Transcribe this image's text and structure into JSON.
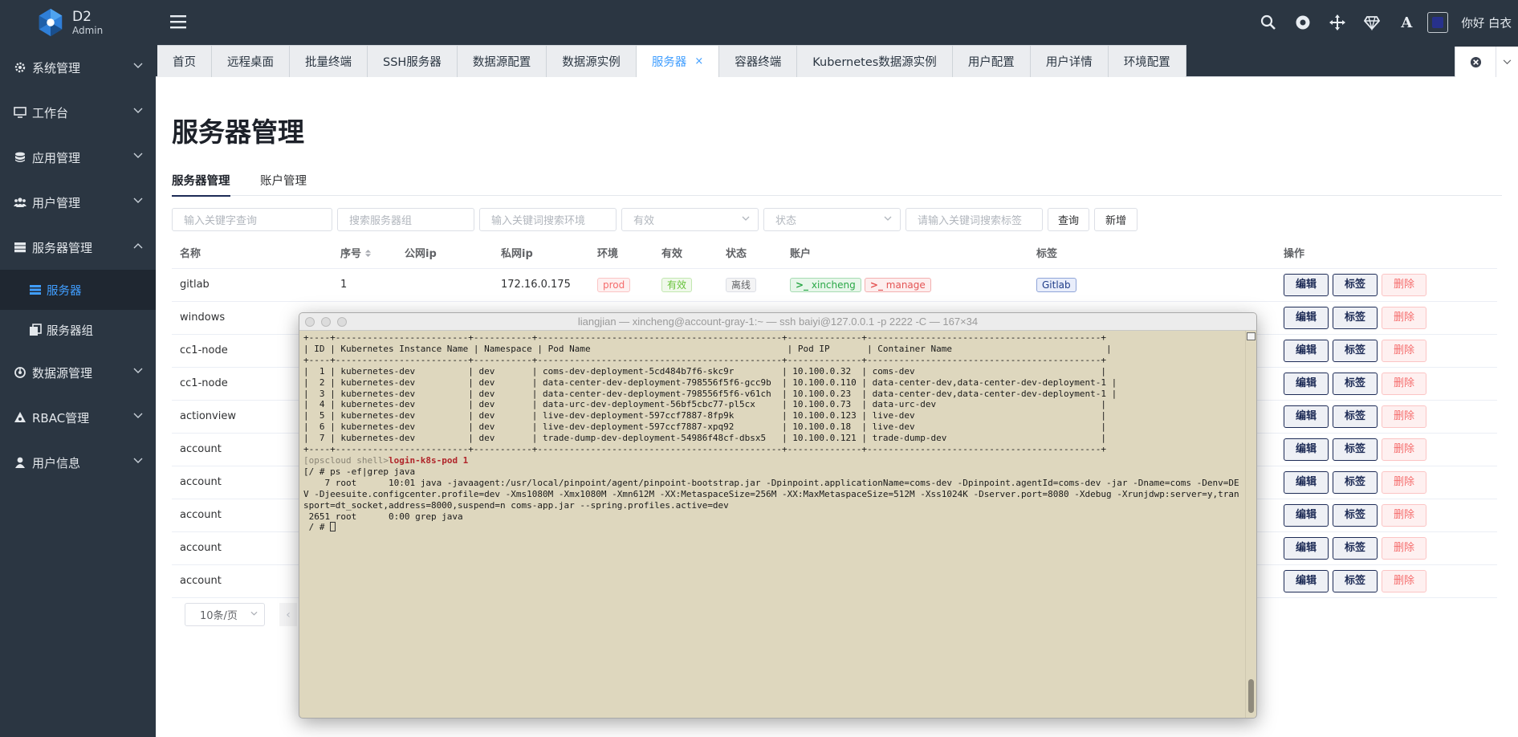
{
  "app": {
    "logo_title": "D2",
    "logo_subtitle": "Admin",
    "greeting": "你好 白衣"
  },
  "sidebar": {
    "items": [
      {
        "label": "系统管理",
        "icon": "gear-icon"
      },
      {
        "label": "工作台",
        "icon": "monitor-icon"
      },
      {
        "label": "应用管理",
        "icon": "database-icon"
      },
      {
        "label": "用户管理",
        "icon": "users-icon"
      },
      {
        "label": "服务器管理",
        "icon": "server-icon",
        "expanded": true
      },
      {
        "label": "数据源管理",
        "icon": "datasource-icon"
      },
      {
        "label": "RBAC管理",
        "icon": "rbac-icon"
      },
      {
        "label": "用户信息",
        "icon": "user-icon"
      }
    ],
    "sub_items": [
      {
        "label": "服务器",
        "icon": "list-icon",
        "active": true
      },
      {
        "label": "服务器组",
        "icon": "copy-icon"
      }
    ]
  },
  "tabs": [
    {
      "label": "首页"
    },
    {
      "label": "远程桌面"
    },
    {
      "label": "批量终端"
    },
    {
      "label": "SSH服务器"
    },
    {
      "label": "数据源配置"
    },
    {
      "label": "数据源实例"
    },
    {
      "label": "服务器",
      "active": true,
      "closable": true
    },
    {
      "label": "容器终端"
    },
    {
      "label": "Kubernetes数据源实例"
    },
    {
      "label": "用户配置"
    },
    {
      "label": "用户详情"
    },
    {
      "label": "环境配置"
    }
  ],
  "page": {
    "title": "服务器管理",
    "subtabs": [
      {
        "label": "服务器管理",
        "active": true
      },
      {
        "label": "账户管理"
      }
    ]
  },
  "filters": {
    "keyword": "输入关键字查询",
    "group": "搜索服务器组",
    "env": "输入关键词搜索环境",
    "valid": "有效",
    "status": "状态",
    "tag": "请输入关键词搜索标签",
    "query_label": "查询",
    "add_label": "新增"
  },
  "table": {
    "headers": [
      "名称",
      "序号",
      "公网ip",
      "私网ip",
      "环境",
      "有效",
      "状态",
      "账户",
      "标签",
      "操作"
    ],
    "rows": [
      {
        "name": "gitlab",
        "seq": "1",
        "public_ip": "",
        "private_ip": "172.16.0.175",
        "env": "prod",
        "valid": "有效",
        "status": "离线",
        "accounts": [
          "xincheng",
          "manage"
        ],
        "tag": "Gitlab"
      },
      {
        "name": "windows"
      },
      {
        "name": "cc1-node"
      },
      {
        "name": "cc1-node"
      },
      {
        "name": "actionview"
      },
      {
        "name": "account"
      },
      {
        "name": "account"
      },
      {
        "name": "account"
      },
      {
        "name": "account"
      },
      {
        "name": "account"
      }
    ],
    "ops": {
      "edit": "编辑",
      "tag": "标签",
      "delete": "删除"
    }
  },
  "pagination": {
    "page_size": "10条/页",
    "prev": "‹"
  },
  "terminal": {
    "title": "liangjian — xincheng@account-gray-1:~ — ssh baiyi@127.0.0.1 -p 2222 -C — 167×34",
    "table_lines": [
      "+----+-------------------------+-----------+----------------------------------------------+--------------+--------------------------------------------+",
      "| ID | Kubernetes Instance Name | Namespace | Pod Name                                     | Pod IP       | Container Name                             |",
      "+----+-------------------------+-----------+----------------------------------------------+--------------+--------------------------------------------+",
      "|  1 | kubernetes-dev          | dev       | coms-dev-deployment-5cd484b7f6-skc9r         | 10.100.0.32  | coms-dev                                   |",
      "|  2 | kubernetes-dev          | dev       | data-center-dev-deployment-798556f5f6-gcc9b  | 10.100.0.110 | data-center-dev,data-center-dev-deployment-1 |",
      "|  3 | kubernetes-dev          | dev       | data-center-dev-deployment-798556f5f6-v61ch  | 10.100.0.23  | data-center-dev,data-center-dev-deployment-1 |",
      "|  4 | kubernetes-dev          | dev       | data-urc-dev-deployment-56bf5cbc77-pl5cx     | 10.100.0.73  | data-urc-dev                               |",
      "|  5 | kubernetes-dev          | dev       | live-dev-deployment-597ccf7887-8fp9k         | 10.100.0.123 | live-dev                                   |",
      "|  6 | kubernetes-dev          | dev       | live-dev-deployment-597ccf7887-xpq92         | 10.100.0.18  | live-dev                                   |",
      "|  7 | kubernetes-dev          | dev       | trade-dump-dev-deployment-54986f48cf-dbsx5   | 10.100.0.121 | trade-dump-dev                             |",
      "+----+-------------------------+-----------+----------------------------------------------+--------------+--------------------------------------------+"
    ],
    "prompt": "[opscloud shell>",
    "command": "login-k8s-pod 1",
    "ps_command": "[/ # ps -ef|grep java",
    "ps_output": "    7 root      10:01 java -javaagent:/usr/local/pinpoint/agent/pinpoint-bootstrap.jar -Dpinpoint.applicationName=coms-dev -Dpinpoint.agentId=coms-dev -jar -Dname=coms -Denv=DEV -Djeesuite.configcenter.profile=dev -Xms1080M -Xmx1080M -Xmn612M -XX:MetaspaceSize=256M -XX:MaxMetaspaceSize=512M -Xss1024K -Dserver.port=8080 -Xdebug -Xrunjdwp:server=y,transport=dt_socket,address=8000,suspend=n coms-app.jar --spring.profiles.active=dev",
    "grep_line": " 2651 root      0:00 grep java",
    "final_prompt": " / # "
  },
  "colors": {
    "sidebar_bg": "#2b3642",
    "accent": "#409eff",
    "terminal_bg": "#ded7be"
  }
}
